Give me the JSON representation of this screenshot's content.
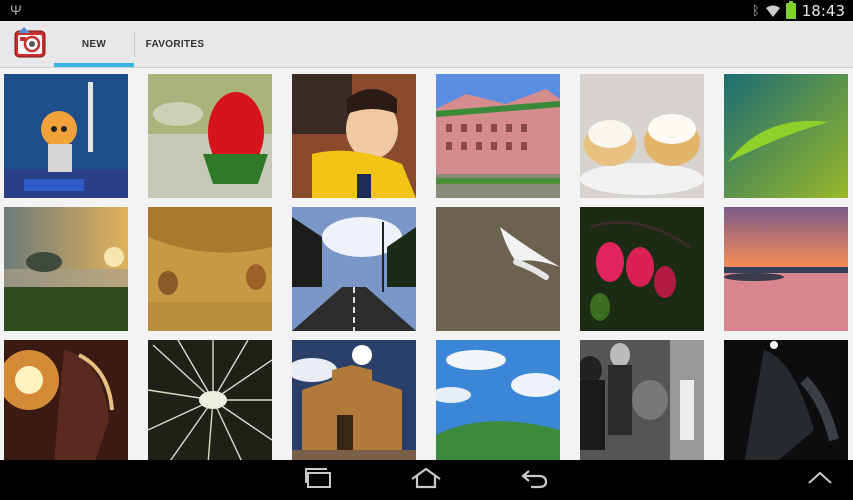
{
  "status_bar": {
    "time": "18:43"
  },
  "tabs": {
    "new_label": "NEW",
    "favorites_label": "FAVORITES"
  },
  "grid": {
    "columns": 6,
    "rows": 3
  },
  "accent_color": "#33b5e5",
  "icons": [
    "usb-icon",
    "bluetooth-icon",
    "wifi-icon",
    "battery-icon",
    "app-camera-icon",
    "recent-apps-icon",
    "home-icon",
    "back-icon",
    "chevron-up-icon"
  ]
}
